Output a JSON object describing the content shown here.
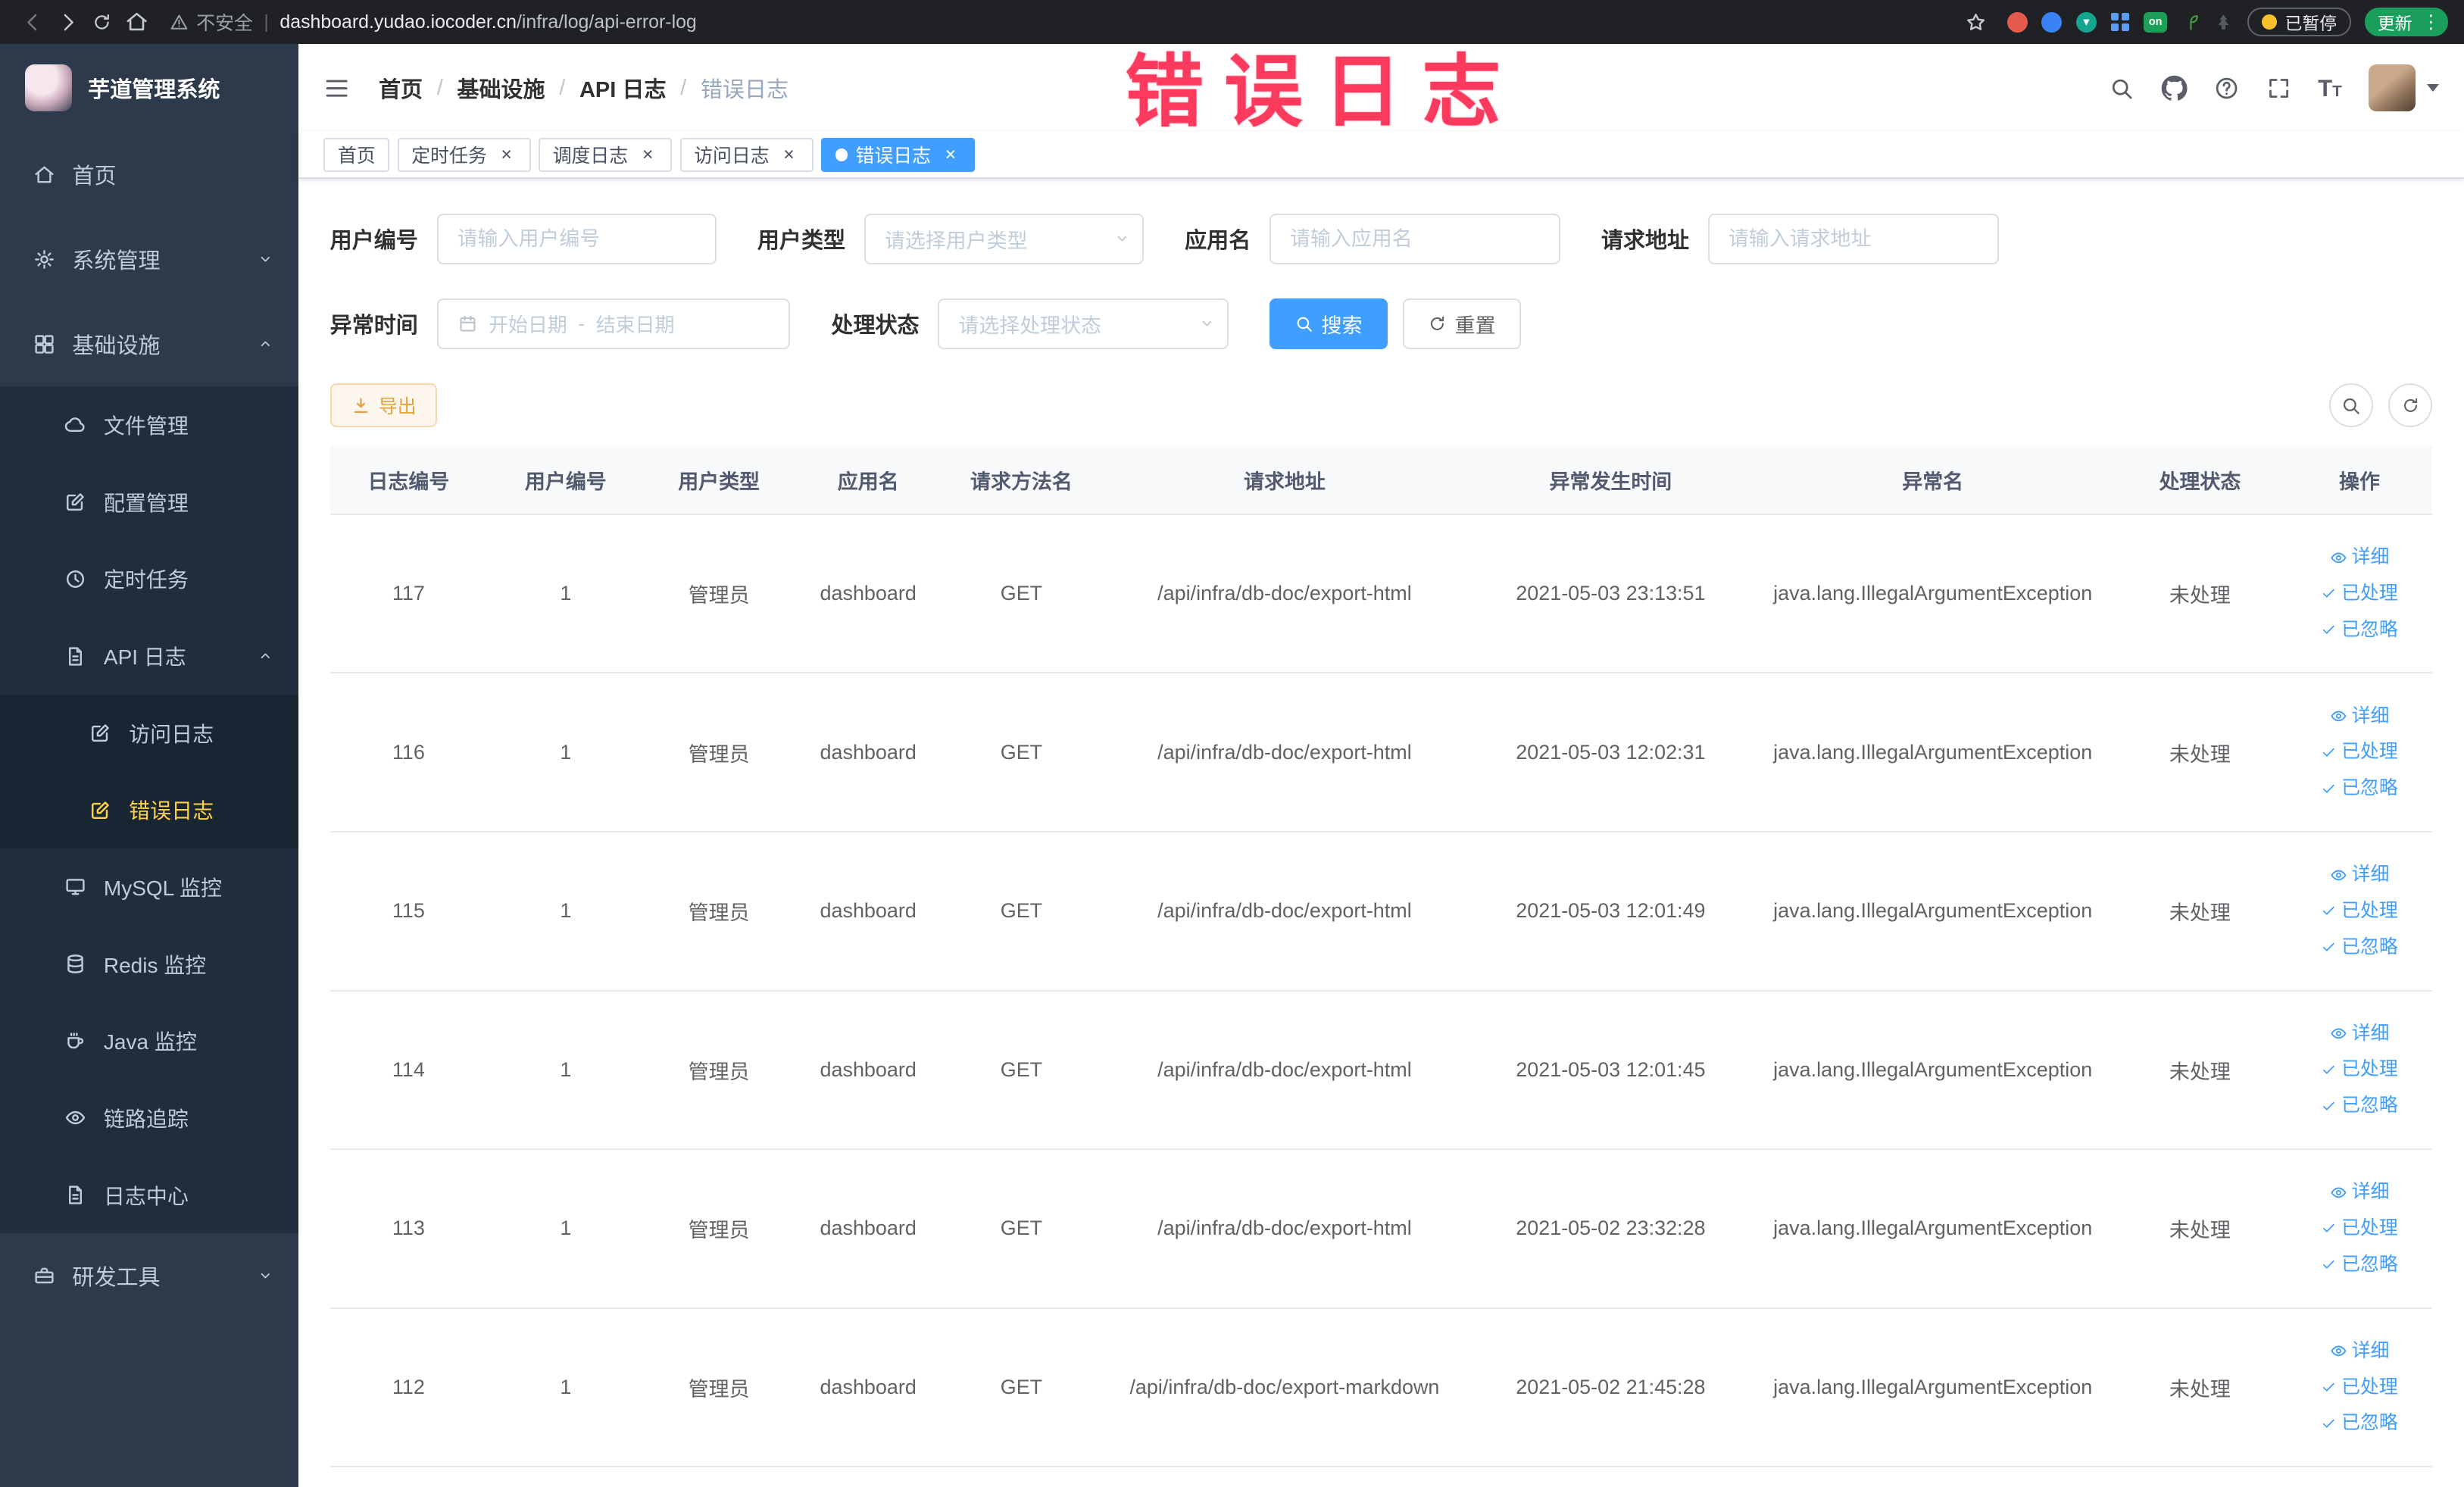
{
  "annotation": "错误日志",
  "browser": {
    "security_label": "不安全",
    "url_host": "dashboard.yudao.iocoder.cn",
    "url_path": "/infra/log/api-error-log",
    "extension_on_label": "on",
    "paused_label": "已暂停",
    "update_label": "更新"
  },
  "sidebar": {
    "logo_title": "芋道管理系统",
    "menu": [
      {
        "key": "home",
        "label": "首页",
        "icon": "home",
        "level": 1
      },
      {
        "key": "system-mgmt",
        "label": "系统管理",
        "icon": "gear",
        "level": 1,
        "expandable": true,
        "expanded": false
      },
      {
        "key": "infra",
        "label": "基础设施",
        "icon": "grid",
        "level": 1,
        "expandable": true,
        "expanded": true
      },
      {
        "key": "file-mgmt",
        "label": "文件管理",
        "icon": "cloud",
        "level": 2
      },
      {
        "key": "config-mgmt",
        "label": "配置管理",
        "icon": "editsq",
        "level": 2
      },
      {
        "key": "scheduled-job",
        "label": "定时任务",
        "icon": "clock",
        "level": 2
      },
      {
        "key": "api-log",
        "label": "API 日志",
        "icon": "filetext",
        "level": 2,
        "expandable": true,
        "expanded": true
      },
      {
        "key": "access-log",
        "label": "访问日志",
        "icon": "editsq",
        "level": 3
      },
      {
        "key": "error-log",
        "label": "错误日志",
        "icon": "editsq",
        "level": 3,
        "active": true
      },
      {
        "key": "mysql-monitor",
        "label": "MySQL 监控",
        "icon": "monitor",
        "level": 2
      },
      {
        "key": "redis-monitor",
        "label": "Redis 监控",
        "icon": "db",
        "level": 2
      },
      {
        "key": "java-monitor",
        "label": "Java 监控",
        "icon": "coffee",
        "level": 2
      },
      {
        "key": "trace",
        "label": "链路追踪",
        "icon": "eye",
        "level": 2
      },
      {
        "key": "log-center",
        "label": "日志中心",
        "icon": "filetext",
        "level": 2
      },
      {
        "key": "dev-tools",
        "label": "研发工具",
        "icon": "tool",
        "level": 1,
        "expandable": true,
        "expanded": false
      }
    ]
  },
  "breadcrumb": [
    "首页",
    "基础设施",
    "API 日志",
    "错误日志"
  ],
  "tabs": [
    {
      "label": "首页",
      "closable": false,
      "active": false
    },
    {
      "label": "定时任务",
      "closable": true,
      "active": false
    },
    {
      "label": "调度日志",
      "closable": true,
      "active": false
    },
    {
      "label": "访问日志",
      "closable": true,
      "active": false
    },
    {
      "label": "错误日志",
      "closable": true,
      "active": true
    }
  ],
  "filters": {
    "user_id": {
      "label": "用户编号",
      "placeholder": "请输入用户编号"
    },
    "user_type": {
      "label": "用户类型",
      "placeholder": "请选择用户类型"
    },
    "app_name": {
      "label": "应用名",
      "placeholder": "请输入应用名"
    },
    "request_url": {
      "label": "请求地址",
      "placeholder": "请输入请求地址"
    },
    "exception_time": {
      "label": "异常时间",
      "start_placeholder": "开始日期",
      "separator": "-",
      "end_placeholder": "结束日期"
    },
    "process_status": {
      "label": "处理状态",
      "placeholder": "请选择处理状态"
    },
    "search_label": "搜索",
    "reset_label": "重置"
  },
  "toolbar": {
    "export_label": "导出"
  },
  "table": {
    "headers": [
      "日志编号",
      "用户编号",
      "用户类型",
      "应用名",
      "请求方法名",
      "请求地址",
      "异常发生时间",
      "异常名",
      "处理状态",
      "操作"
    ],
    "actions": [
      {
        "label": "详细",
        "icon": "eyesm"
      },
      {
        "label": "已处理",
        "icon": "check"
      },
      {
        "label": "已忽略",
        "icon": "check"
      }
    ],
    "rows": [
      {
        "id": "117",
        "user_id": "1",
        "user_type": "管理员",
        "app": "dashboard",
        "method": "GET",
        "url": "/api/infra/db-doc/export-html",
        "time": "2021-05-03 23:13:51",
        "exception": "java.lang.IllegalArgumentException",
        "status": "未处理"
      },
      {
        "id": "116",
        "user_id": "1",
        "user_type": "管理员",
        "app": "dashboard",
        "method": "GET",
        "url": "/api/infra/db-doc/export-html",
        "time": "2021-05-03 12:02:31",
        "exception": "java.lang.IllegalArgumentException",
        "status": "未处理"
      },
      {
        "id": "115",
        "user_id": "1",
        "user_type": "管理员",
        "app": "dashboard",
        "method": "GET",
        "url": "/api/infra/db-doc/export-html",
        "time": "2021-05-03 12:01:49",
        "exception": "java.lang.IllegalArgumentException",
        "status": "未处理"
      },
      {
        "id": "114",
        "user_id": "1",
        "user_type": "管理员",
        "app": "dashboard",
        "method": "GET",
        "url": "/api/infra/db-doc/export-html",
        "time": "2021-05-03 12:01:45",
        "exception": "java.lang.IllegalArgumentException",
        "status": "未处理"
      },
      {
        "id": "113",
        "user_id": "1",
        "user_type": "管理员",
        "app": "dashboard",
        "method": "GET",
        "url": "/api/infra/db-doc/export-html",
        "time": "2021-05-02 23:32:28",
        "exception": "java.lang.IllegalArgumentException",
        "status": "未处理"
      },
      {
        "id": "112",
        "user_id": "1",
        "user_type": "管理员",
        "app": "dashboard",
        "method": "GET",
        "url": "/api/infra/db-doc/export-markdown",
        "time": "2021-05-02 21:45:28",
        "exception": "java.lang.IllegalArgumentException",
        "status": "未处理"
      }
    ]
  },
  "colors": {
    "primary": "#409eff",
    "active_menu": "#ffd04b",
    "warning": "#e6a23c",
    "annotation": "#fb3a5d"
  }
}
